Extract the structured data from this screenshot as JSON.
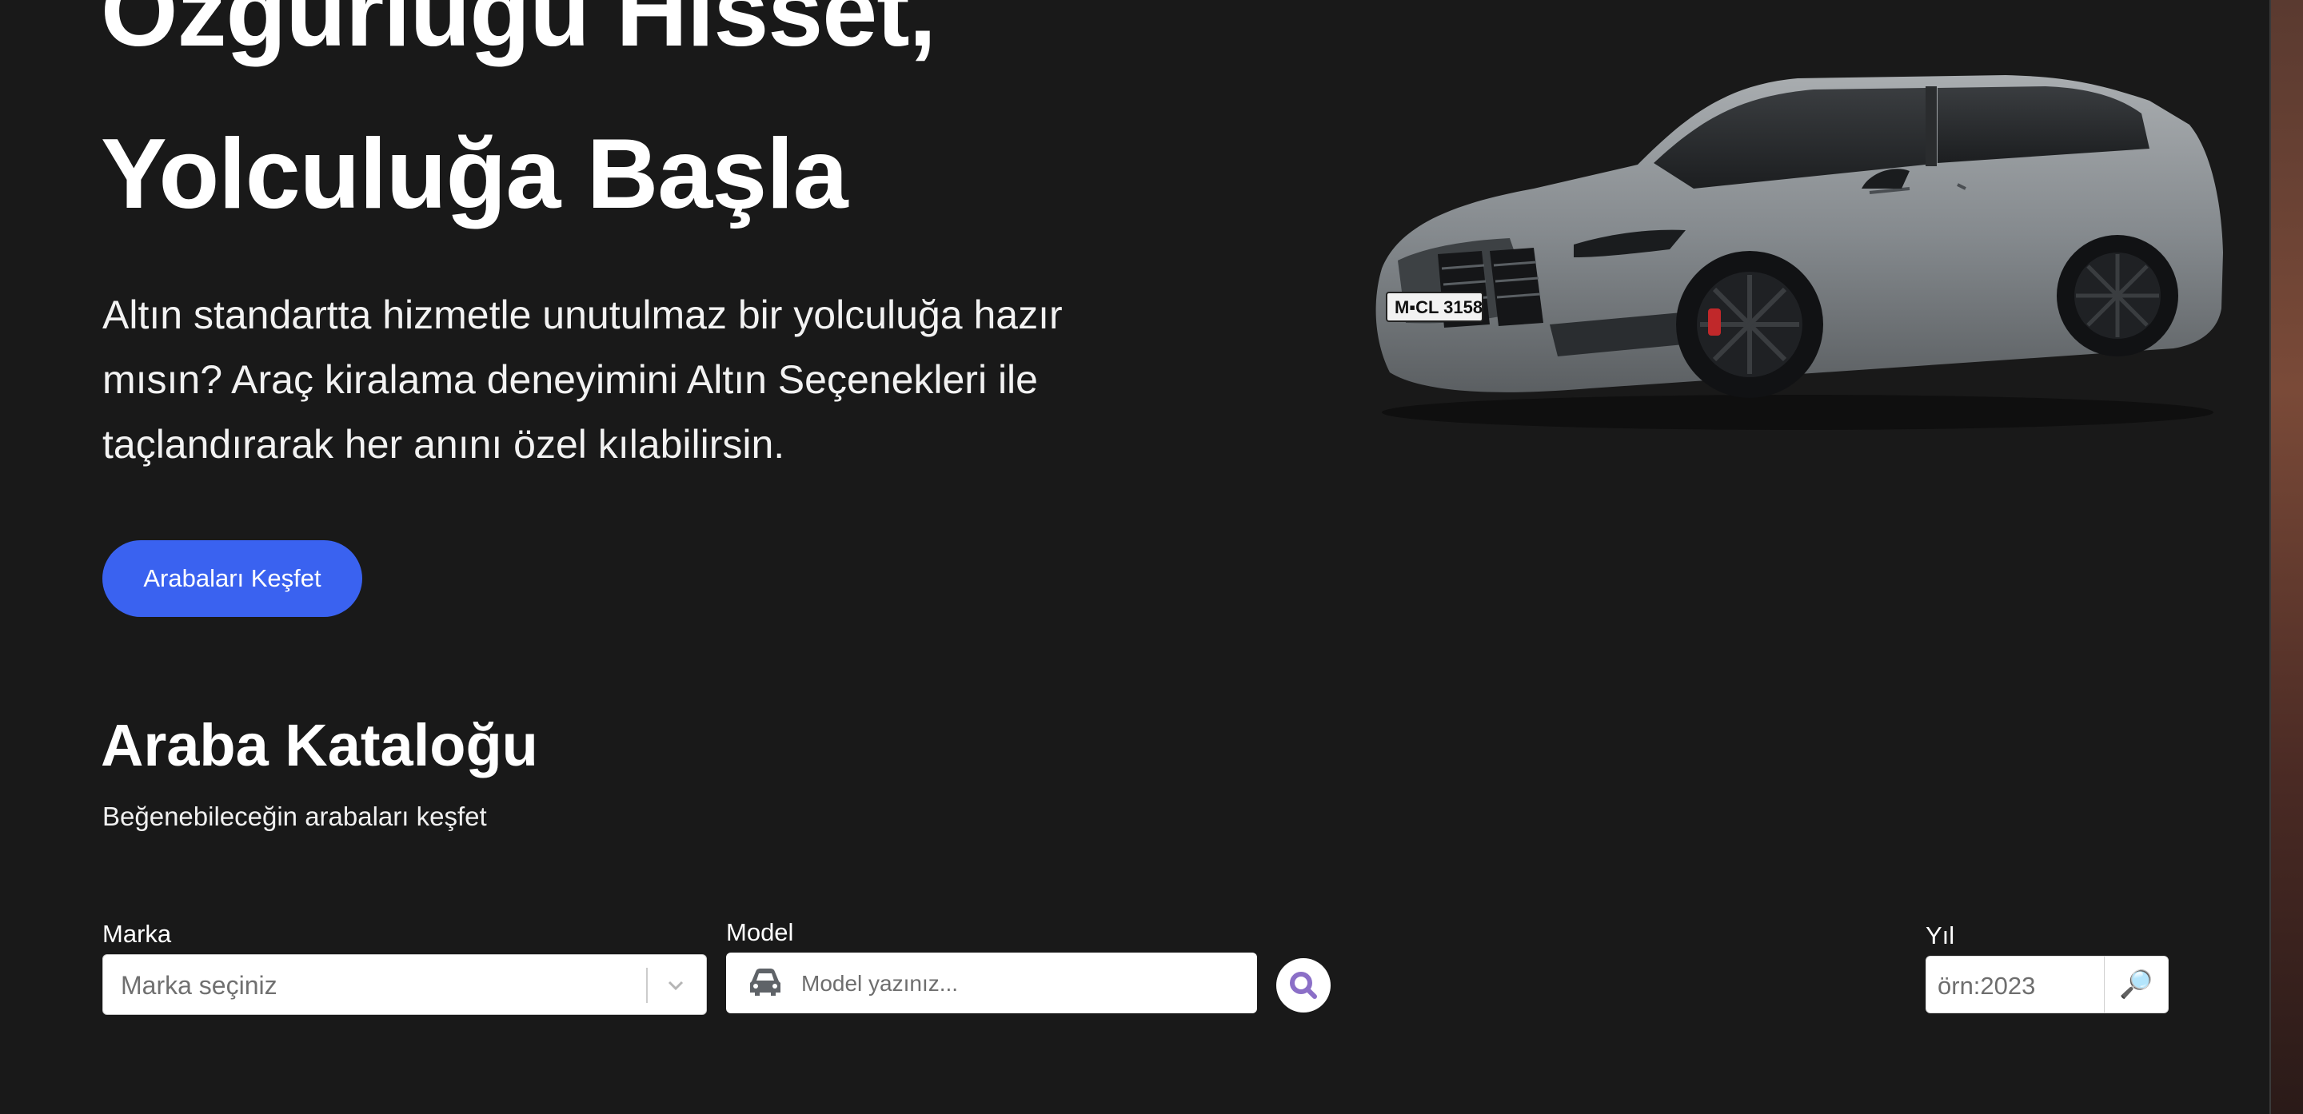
{
  "hero": {
    "title_line1": "Özgürlüğü Hisset,",
    "title_line2": "Yolculuğa Başla",
    "subtitle": "Altın standartta hizmetle unutulmaz bir yolculuğa hazır mısın? Araç kiralama deneyimini Altın Seçenekleri ile taçlandırarak her anını özel kılabilirsin.",
    "cta_label": "Arabaları Keşfet",
    "car_plate": "M▪CL 3158"
  },
  "catalog": {
    "title": "Araba Kataloğu",
    "subtitle": "Beğenebileceğin arabaları keşfet"
  },
  "filters": {
    "brand_label": "Marka",
    "brand_placeholder": "Marka seçiniz",
    "model_label": "Model",
    "model_placeholder": "Model yazınız...",
    "year_label": "Yıl",
    "year_placeholder": "örn:2023",
    "year_search_icon": "🔎"
  },
  "colors": {
    "background": "#191919",
    "accent": "#3a62f0",
    "search_icon": "#8b6fc7"
  }
}
